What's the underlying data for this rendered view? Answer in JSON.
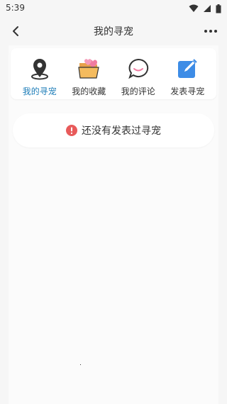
{
  "status": {
    "time": "5:39"
  },
  "header": {
    "title": "我的寻宠"
  },
  "tabs": [
    {
      "label": "我的寻宠",
      "icon": "location-pin-icon",
      "active": true
    },
    {
      "label": "我的收藏",
      "icon": "folder-heart-icon",
      "active": false
    },
    {
      "label": "我的评论",
      "icon": "chat-bubble-icon",
      "active": false
    },
    {
      "label": "发表寻宠",
      "icon": "edit-square-icon",
      "active": false
    }
  ],
  "empty_notice": {
    "text": "还没有发表过寻宠",
    "icon": "alert-icon"
  },
  "colors": {
    "accent": "#1e7db8",
    "alert": "#e85a5a",
    "edit_icon": "#3d8ce6",
    "folder": "#f0a443",
    "heart": "#f07aa0"
  }
}
